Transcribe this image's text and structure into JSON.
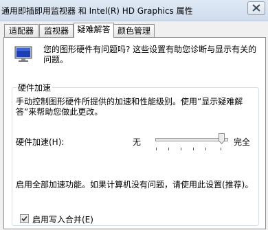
{
  "window": {
    "title": "通用即插即用监视器 和 Intel(R) HD Graphics 属性"
  },
  "tabs": [
    {
      "label": "适配器",
      "active": false
    },
    {
      "label": "监视器",
      "active": false
    },
    {
      "label": "疑难解答",
      "active": true
    },
    {
      "label": "颜色管理",
      "active": false
    }
  ],
  "troubleshoot": {
    "intro": "您的图形硬件有问题吗? 这些设置有助您诊断与显示有关的问题。",
    "group_title": "硬件加速",
    "group_desc": "手动控制图形硬件所提供的加速和性能级别。使用“显示疑难解答”来帮助您做此更改。",
    "accel_label": "硬件加速(H):",
    "min_label": "无",
    "max_label": "完全",
    "accel_level_fraction": 1.0,
    "level_desc": "启用全部加速功能。如果计算机没有问题，请使用此设置(推荐)。",
    "write_combining_label": "启用写入合并(E)",
    "write_combining_checked": true
  }
}
